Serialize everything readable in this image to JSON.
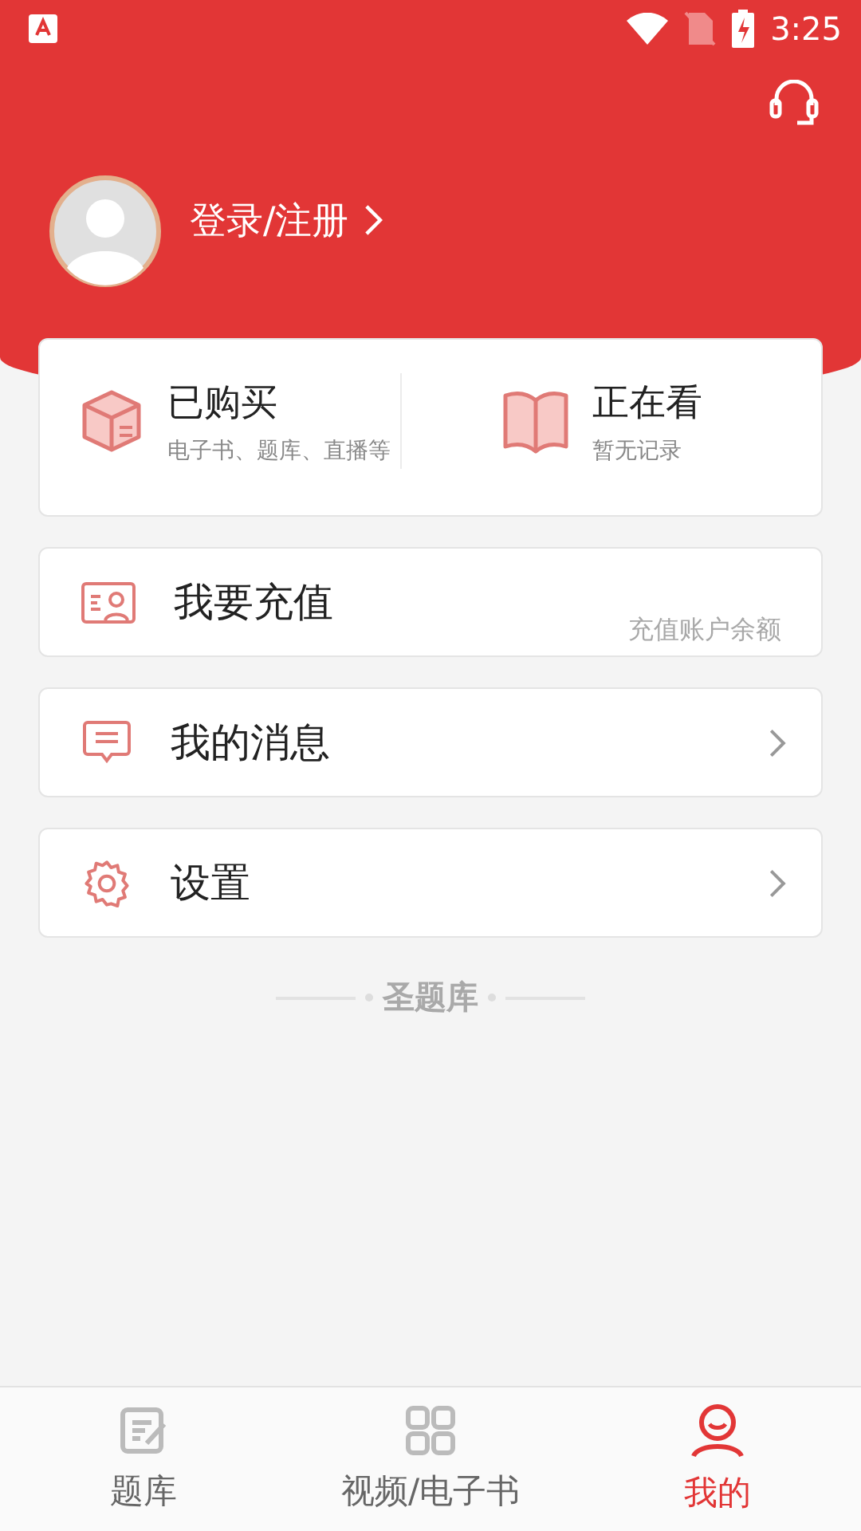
{
  "status_bar": {
    "time": "3:25"
  },
  "profile": {
    "login_label": "登录/注册"
  },
  "summary": [
    {
      "title": "已购买",
      "subtitle": "电子书、题库、直播等"
    },
    {
      "title": "正在看",
      "subtitle": "暂无记录"
    }
  ],
  "menu": [
    {
      "kind": "note",
      "label": "我要充值",
      "note": "充值账户余额"
    },
    {
      "kind": "link",
      "label": "我的消息"
    },
    {
      "kind": "link",
      "label": "设置"
    }
  ],
  "brand": "圣题库",
  "tabs": [
    {
      "label": "题库",
      "selected": false
    },
    {
      "label": "视频/电子书",
      "selected": false
    },
    {
      "label": "我的",
      "selected": true
    }
  ]
}
